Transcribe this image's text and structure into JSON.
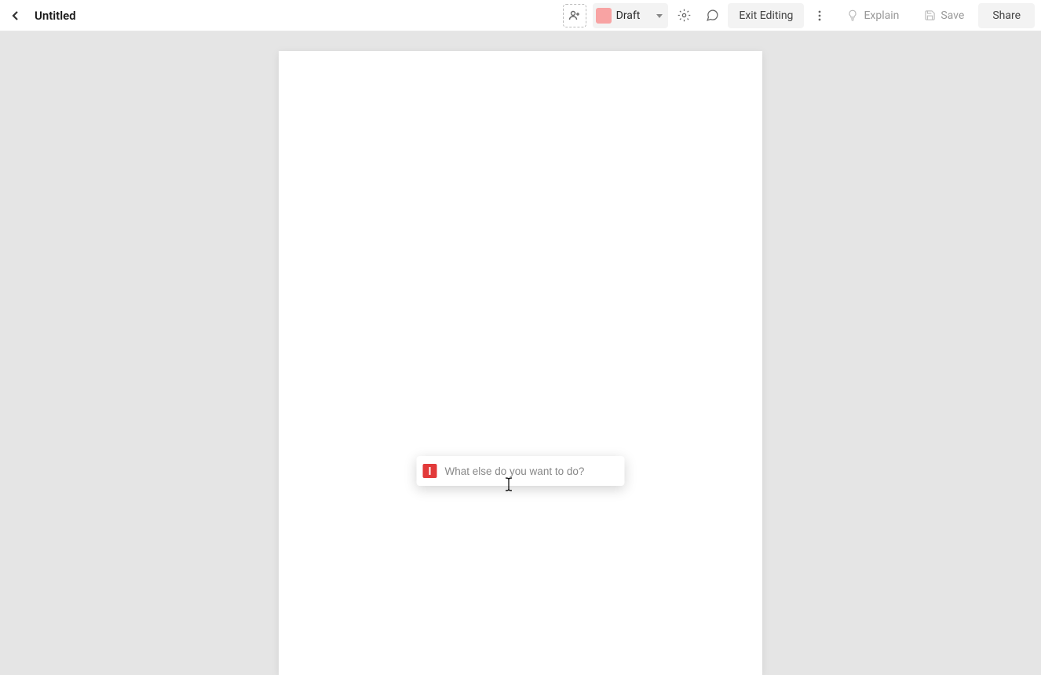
{
  "header": {
    "title": "Untitled",
    "status": {
      "label": "Draft",
      "color": "#f8a3a3"
    },
    "buttons": {
      "exit_editing": "Exit Editing",
      "explain": "Explain",
      "save": "Save",
      "share": "Share"
    }
  },
  "command": {
    "placeholder": "What else do you want to do?",
    "value": ""
  }
}
